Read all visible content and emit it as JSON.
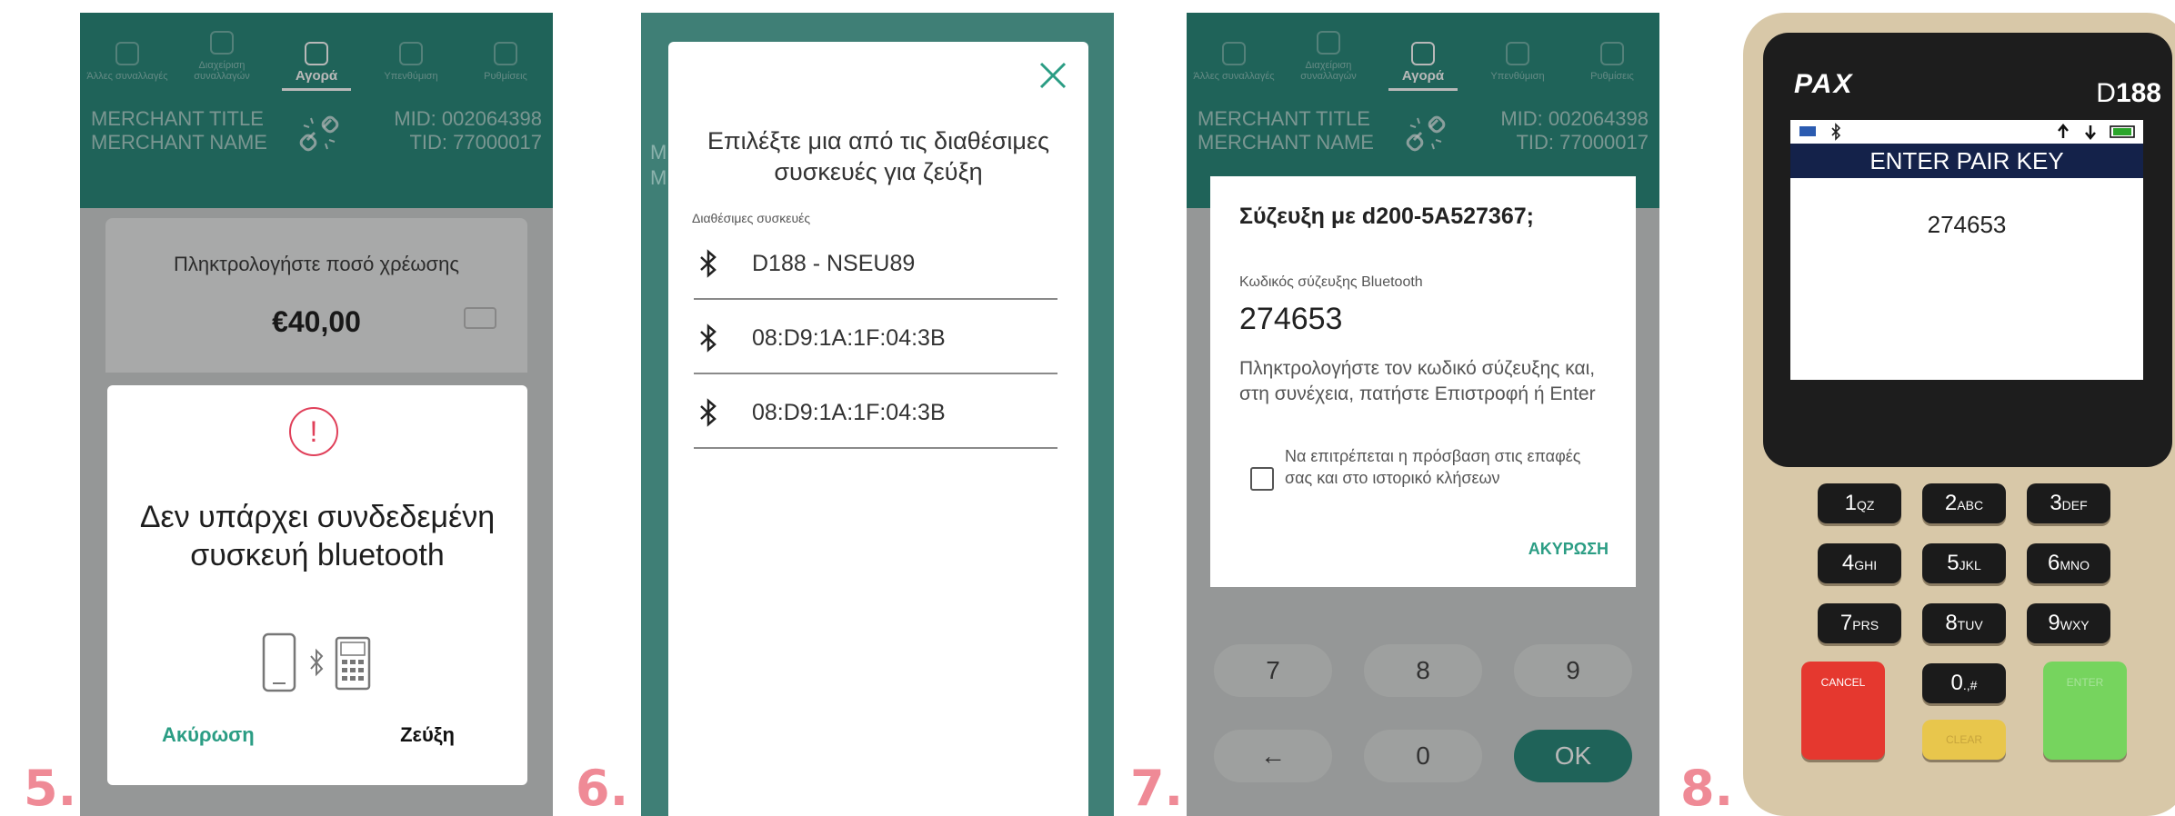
{
  "steps": [
    "5.",
    "6.",
    "7.",
    "8."
  ],
  "app": {
    "tabs": [
      {
        "label": "Άλλες συναλλαγές"
      },
      {
        "label": "Διαχείριση συναλλαγών"
      },
      {
        "label": "Αγορά"
      },
      {
        "label": "Υπενθύμιση"
      },
      {
        "label": "Ρυθμίσεις"
      }
    ],
    "active_tab": "Αγορά",
    "merchant_title": "MERCHANT TITLE",
    "merchant_name": "MERCHANT NAME",
    "mid": "MID: 002064398",
    "tid": "TID: 77000017"
  },
  "screen5": {
    "amount_prompt": "Πληκτρολογήστε ποσό χρέωσης",
    "amount": "€40,00",
    "dialog_title": "Δεν υπάρχει συνδεδεμένη συσκευή bluetooth",
    "cancel": "Ακύρωση",
    "pair": "Ζεύξη",
    "alert_icon": "!"
  },
  "screen6": {
    "title": "Επιλέξτε μια από τις διαθέσιμες συσκευές για ζεύξη",
    "subtitle": "Διαθέσιμες συσκευές",
    "devices": [
      "D188 - NSEU89",
      "08:D9:1A:1F:04:3B",
      "08:D9:1A:1F:04:3B"
    ]
  },
  "screen7": {
    "title": "Σύζευξη με d200-5A527367;",
    "code_label": "Κωδικός σύζευξης Bluetooth",
    "code": "274653",
    "help": "Πληκτρολογήστε τον κωδικό σύζευξης και, στη συνέχεια, πατήστε Επιστροφή ή Enter",
    "checkbox_label": "Να επιτρέπεται η πρόσβαση στις επαφές σας και στο ιστορικό κλήσεων",
    "cancel": "ΑΚΥΡΩΣΗ",
    "keys": [
      "7",
      "8",
      "9",
      "←",
      "0",
      "OK"
    ]
  },
  "terminal": {
    "brand": "PAX",
    "model_prefix": "D",
    "model_number": "188",
    "screen_header": "ENTER PAIR KEY",
    "screen_code": "274653",
    "keys": [
      {
        "main": "1",
        "sub": "QZ"
      },
      {
        "main": "2",
        "sub": "ABC"
      },
      {
        "main": "3",
        "sub": "DEF"
      },
      {
        "main": "4",
        "sub": "GHI"
      },
      {
        "main": "5",
        "sub": "JKL"
      },
      {
        "main": "6",
        "sub": "MNO"
      },
      {
        "main": "7",
        "sub": "PRS"
      },
      {
        "main": "8",
        "sub": "TUV"
      },
      {
        "main": "9",
        "sub": "WXY"
      },
      {
        "main": "0",
        "sub": ".,#"
      }
    ],
    "cancel_label": "CANCEL",
    "clear_label": "CLEAR",
    "enter_label": "ENTER"
  },
  "colors": {
    "brand_teal": "#2b8a7c",
    "accent_green_text": "#2b9d84",
    "alert_red": "#e0405a",
    "step_pink": "#ef8a96",
    "terminal_body": "#d8c8a8",
    "terminal_lcd_header": "#14224a"
  }
}
